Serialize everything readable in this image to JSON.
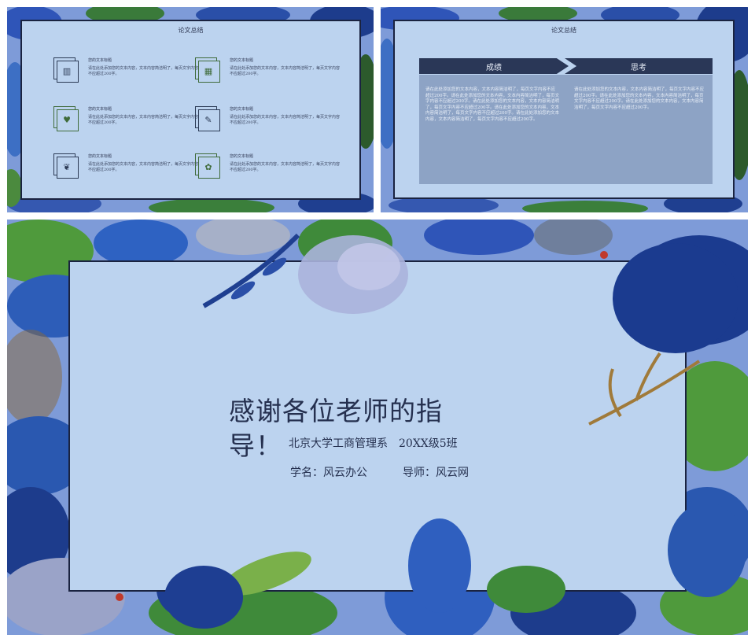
{
  "slide1": {
    "title": "论文总结",
    "items": [
      {
        "title": "您的文本标题",
        "text": "请在此处添加您的文本内容，文本内容简洁明了，每页文字内容不应超过200字。",
        "icon": "chart-icon"
      },
      {
        "title": "您的文本标题",
        "text": "请在此处添加您的文本内容，文本内容简洁明了，每页文字内容不应超过200字。",
        "icon": "calendar-icon"
      },
      {
        "title": "您的文本标题",
        "text": "请在此处添加您的文本内容，文本内容简洁明了，每页文字内容不应超过200字。",
        "icon": "heart-icon"
      },
      {
        "title": "您的文本标题",
        "text": "请在此处添加您的文本内容，文本内容简洁明了，每页文字内容不应超过200字。",
        "icon": "pushpin-icon"
      },
      {
        "title": "您的文本标题",
        "text": "请在此处添加您的文本内容，文本内容简洁明了，每页文字内容不应超过200字。",
        "icon": "leaf-icon"
      },
      {
        "title": "您的文本标题",
        "text": "请在此处添加您的文本内容，文本内容简洁明了，每页文字内容不应超过200字。",
        "icon": "palette-icon"
      }
    ],
    "glyphs": [
      "▥",
      "▦",
      "♥",
      "✎",
      "❦",
      "✿"
    ]
  },
  "slide2": {
    "title": "论文总结",
    "left_header": "成绩",
    "right_header": "思考",
    "left_text": "请在此处添加您的文本内容，文本内容简洁明了，每页文字内容不应超过200字。请在此处添加您的文本内容，文本内容简洁明了，每页文字内容不应超过200字。请在此处添加您的文本内容，文本内容简洁明了，每页文字内容不应超过200字。请在此处添加您的文本内容，文本内容简洁明了，每页文字内容不应超过200字。请在此处添加您的文本内容，文本内容简洁明了，每页文字内容不应超过200字。",
    "right_text": "请在此处添加您的文本内容，文本内容简洁明了，每页文字内容不应超过200字。请在此处添加您的文本内容，文本内容简洁明了，每页文字内容不应超过200字。请在此处添加您的文本内容，文本内容简洁明了，每页文字内容不应超过200字。"
  },
  "slide3": {
    "thanks": "感谢各位老师的指导！",
    "dept": "北京大学工商管理系　20XX级5班",
    "student": "学名：风云办公",
    "advisor": "导师：风云网"
  },
  "colors": {
    "background": "#7e9bd8",
    "panel": "#bcd3ef",
    "frame": "#1a2340",
    "header": "#2a3757",
    "text_block": "#8da3c5"
  }
}
